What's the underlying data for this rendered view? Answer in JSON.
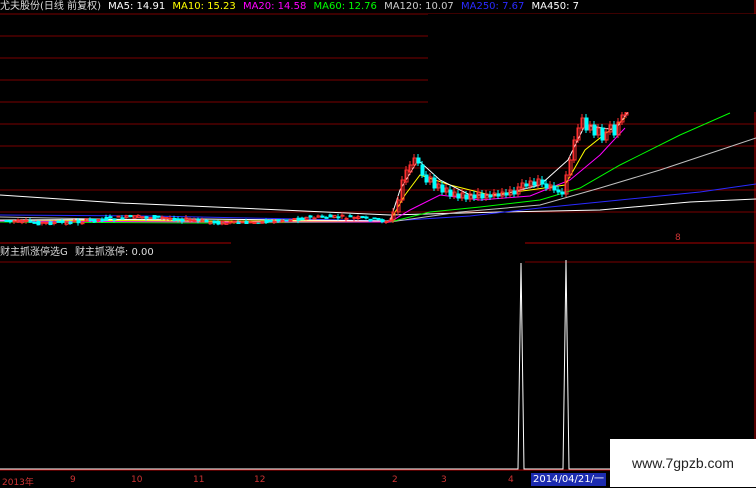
{
  "main_legend": {
    "title": "尤夫股份(日线 前复权)",
    "items": [
      {
        "label": "MA5: 14.91",
        "color": "#ffffff"
      },
      {
        "label": "MA10: 15.23",
        "color": "#ffff00"
      },
      {
        "label": "MA20: 14.58",
        "color": "#ff00ff"
      },
      {
        "label": "MA60: 12.76",
        "color": "#00ff00"
      },
      {
        "label": "MA120: 10.07",
        "color": "#c0c0c0"
      },
      {
        "label": "MA250: 7.67",
        "color": "#2020ff"
      },
      {
        "label": "MA450: 7",
        "color": "#ffffff"
      }
    ]
  },
  "sub_legend": {
    "title": "财主抓涨停选G",
    "item": "财主抓涨停: 0.00"
  },
  "right_axis_value": "8",
  "x_ticks": [
    "2013年",
    "9",
    "10",
    "11",
    "12",
    "2",
    "3",
    "4"
  ],
  "cursor_date": "2014/04/21/一",
  "watermark": "www.7gpzb.com",
  "colors": {
    "background": "#000000",
    "grid": "#7a0000",
    "up": "#ff3030",
    "down": "#00ffff",
    "indicator": "#ffffff"
  }
}
